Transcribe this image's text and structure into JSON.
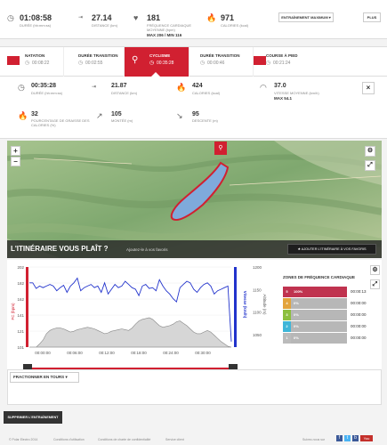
{
  "summary": {
    "duration": {
      "value": "01:08:58",
      "label": "DURÉE (hh:mm:ss)"
    },
    "distance": {
      "value": "27.14",
      "label": "DISTANCE (km)"
    },
    "heart_rate": {
      "value": "181",
      "label": "FRÉQUENCE CARDIAQUE MOYENNE (bpm)",
      "max_min": "MAX 206 / MIN 116"
    },
    "calories": {
      "value": "971",
      "label": "CALORIES (kcal)"
    },
    "training_select": "ENTRAÎNEMENT MAXIMUM",
    "more_button": "PLUS"
  },
  "tabs": [
    {
      "title": "NATATION",
      "value": "00:08:22"
    },
    {
      "title": "DURÉE TRANSITION",
      "value": "00:02:55"
    },
    {
      "title": "CYCLISME",
      "value": "00:35:28"
    },
    {
      "title": "DURÉE TRANSITION",
      "value": "00:00:46"
    },
    {
      "title": "COURSE À PIED",
      "value": "00:21:24"
    }
  ],
  "details": {
    "duration": {
      "value": "00:35:28",
      "label": "DURÉE (hh:mm:ss)"
    },
    "distance": {
      "value": "21.87",
      "label": "DISTANCE (km)"
    },
    "calories": {
      "value": "424",
      "label": "CALORIES (kcal)"
    },
    "speed": {
      "value": "37.0",
      "label": "VITESSE MOYENNE (km/h)",
      "max": "MAX 54.1"
    },
    "fat": {
      "value": "32",
      "label": "POURCENTAGE DE GRAISSE DES CALORIES (%)"
    },
    "ascent": {
      "value": "105",
      "label": "MONTÉE (m)"
    },
    "descent": {
      "value": "95",
      "label": "DESCENTE (m)"
    },
    "close": "×"
  },
  "map": {
    "zoom_in": "+",
    "zoom_out": "−",
    "title": "L'ITINÉRAIRE VOUS PLAÎT ?",
    "subtitle": "Ajoutez-le à vos favoris",
    "add_favorite": "AJOUTER L'ITINÉRAIRE À VOS FAVORIS"
  },
  "chart_data": {
    "type": "line",
    "x_ticks": [
      "00:00:00",
      "00:06:00",
      "00:12:00",
      "00:18:00",
      "00:24:00",
      "00:30:00"
    ],
    "left_axis_label": "FC (bpm)",
    "left_ticks": [
      "202",
      "182",
      "162",
      "141",
      "121",
      "101"
    ],
    "right_axis_label": "Vitesse (km/h)",
    "altitude_axis_label": "Altitude (m)",
    "altitude_ticks": [
      "1200",
      "1150",
      "1100",
      "1050"
    ],
    "series": [
      {
        "name": "Vitesse (km/h)",
        "color": "#2233cc",
        "values": [
          182,
          182,
          175,
          178,
          176,
          178,
          180,
          178,
          172,
          176,
          179,
          170,
          178,
          182,
          188,
          172,
          176,
          178,
          180,
          176,
          178,
          170,
          182,
          168,
          174,
          180,
          176,
          178,
          184,
          180,
          176,
          174,
          166,
          178,
          180,
          175,
          176,
          172,
          186,
          178,
          172,
          168,
          162,
          158,
          176,
          180,
          184,
          182,
          174,
          170,
          176,
          180,
          182,
          178,
          168,
          172,
          174,
          176,
          178,
          108
        ]
      },
      {
        "name": "Altitude (m)",
        "color": "#888888",
        "values": [
          101,
          101,
          101,
          105,
          110,
          118,
          122,
          124,
          125,
          125,
          124,
          122,
          120,
          121,
          123,
          124,
          125,
          126,
          125,
          124,
          122,
          120,
          118,
          119,
          121,
          122,
          123,
          124,
          123,
          122,
          125,
          130,
          134,
          136,
          137,
          138,
          136,
          132,
          128,
          126,
          127,
          128,
          130,
          133,
          134,
          131,
          128,
          124,
          120,
          118,
          118,
          120,
          122,
          120,
          116,
          112,
          108,
          105,
          102,
          101
        ]
      }
    ]
  },
  "zones": {
    "title": "ZONES DE FRÉQUENCE CARDIAQUE",
    "rows": [
      {
        "zone": "5",
        "percent": "100%",
        "time": "00:00:13",
        "color": "#c0334f"
      },
      {
        "zone": "4",
        "percent": "0%",
        "time": "00:00:00",
        "color": "#e3a43b"
      },
      {
        "zone": "3",
        "percent": "0%",
        "time": "00:00:00",
        "color": "#8cbf3f"
      },
      {
        "zone": "2",
        "percent": "0%",
        "time": "00:00:00",
        "color": "#3fb6d8"
      },
      {
        "zone": "1",
        "percent": "0%",
        "time": "00:00:00",
        "color": "#bbbbbb"
      }
    ]
  },
  "split": {
    "label": "FRACTIONNER EN TOURS"
  },
  "delete": {
    "label": "SUPPRIMER L'ENTRAÎNEMENT"
  },
  "footer": {
    "copyright": "© Polar Electro 2014",
    "terms": "Conditions d'utilisation",
    "privacy": "Conditions de charte de confidentialité",
    "help": "Service client",
    "follow": "Suivez-nous sur"
  },
  "colors": {
    "accent": "#d12031",
    "speed": "#2233cc",
    "altitude": "#888888"
  }
}
